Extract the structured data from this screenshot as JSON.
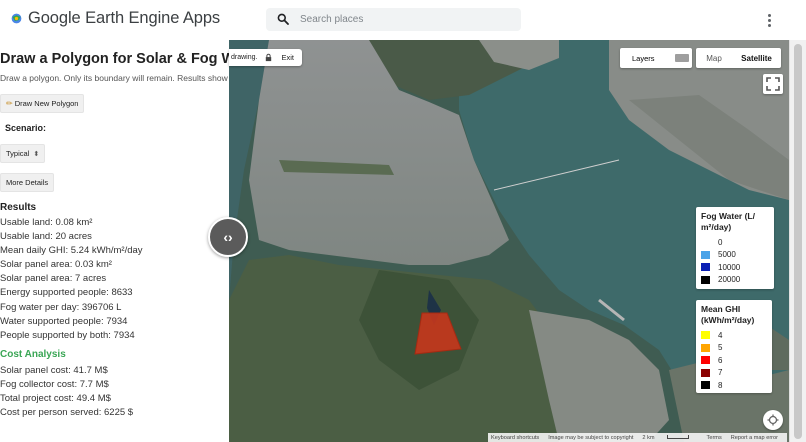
{
  "header": {
    "app_title": "Google Earth Engine Apps",
    "search_placeholder": "Search places"
  },
  "panel": {
    "title": "Draw a Polygon for Solar & Fog Water",
    "subtitle": "Draw a polygon. Only its boundary will remain. Results show",
    "draw_button": "Draw New Polygon",
    "scenario_label": "Scenario:",
    "scenario_value": "Typical",
    "details_button": "More Details",
    "results_title": "Results",
    "results": [
      "Usable land: 0.08 km²",
      "Usable land: 20 acres",
      "Mean daily GHI: 5.24 kWh/m²/day",
      "Solar panel area: 0.03 km²",
      "Solar panel area: 7 acres",
      "Energy supported people: 8633",
      "Fog water per day: 396706 L",
      "Water supported people: 7934",
      "People supported by both: 7934"
    ],
    "cost_title": "Cost Analysis",
    "costs": [
      "Solar panel cost: 41.7 M$",
      "Fog collector cost: 7.7 M$",
      "Total project cost: 49.4 M$",
      "Cost per person served: 6225 $"
    ]
  },
  "map": {
    "drawing_text": "drawing.",
    "exit_label": "Exit",
    "layers_label": "Layers",
    "map_type_map": "Map",
    "map_type_satellite": "Satellite",
    "split_handle": "‹›",
    "polygon_color": "#c7361c",
    "fog_legend": {
      "title": "Fog Water (L/ m²/day)",
      "items": [
        {
          "label": "0",
          "color": "#ffffff"
        },
        {
          "label": "5000",
          "color": "#4aa3e8"
        },
        {
          "label": "10000",
          "color": "#0a1fb5"
        },
        {
          "label": "20000",
          "color": "#000000"
        }
      ]
    },
    "ghi_legend": {
      "title": "Mean GHI (kWh/m²/day)",
      "items": [
        {
          "label": "4",
          "color": "#ffff00"
        },
        {
          "label": "5",
          "color": "#ffa500"
        },
        {
          "label": "6",
          "color": "#ff0000"
        },
        {
          "label": "7",
          "color": "#8b0000"
        },
        {
          "label": "8",
          "color": "#000000"
        }
      ]
    },
    "attribution": {
      "shortcuts": "Keyboard shortcuts",
      "copyright": "Image may be subject to copyright",
      "scale": "2 km",
      "terms": "Terms",
      "report": "Report a map error"
    }
  }
}
